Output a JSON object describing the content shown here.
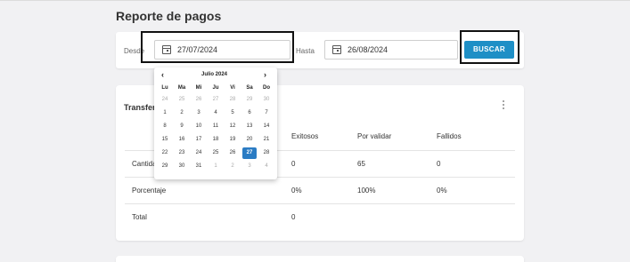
{
  "page_title": "Reporte de pagos",
  "filters": {
    "from_label": "Desde",
    "from_value": "27/07/2024",
    "to_label": "Hasta",
    "to_value": "26/08/2024",
    "search_label": "BUSCAR",
    "accent_color": "#1e8fc6"
  },
  "card": {
    "title": "Transferencias",
    "menu_icon": "kebab-menu-icon",
    "columns": [
      "Exitosos",
      "Por validar",
      "Fallidos"
    ],
    "rows": [
      {
        "label": "Cantidad",
        "values": [
          "0",
          "65",
          "0"
        ]
      },
      {
        "label": "Porcentaje",
        "values": [
          "0%",
          "100%",
          "0%"
        ]
      },
      {
        "label": "Total",
        "values": [
          "0",
          "",
          ""
        ]
      }
    ]
  },
  "calendar": {
    "month": "Julio 2024",
    "prev_icon": "chevron-left-icon",
    "next_icon": "chevron-right-icon",
    "weekdays": [
      "Lu",
      "Ma",
      "Mi",
      "Ju",
      "Vi",
      "Sa",
      "Do"
    ],
    "weeks": [
      [
        "24",
        "25",
        "26",
        "27",
        "28",
        "29",
        "30"
      ],
      [
        "1",
        "2",
        "3",
        "4",
        "5",
        "6",
        "7"
      ],
      [
        "8",
        "9",
        "10",
        "11",
        "12",
        "13",
        "14"
      ],
      [
        "15",
        "16",
        "17",
        "18",
        "19",
        "20",
        "21"
      ],
      [
        "22",
        "23",
        "24",
        "25",
        "26",
        "27",
        "28"
      ],
      [
        "29",
        "30",
        "31",
        "1",
        "2",
        "3",
        "4"
      ]
    ],
    "selected": "27",
    "selected_color": "#2b7cc4"
  }
}
